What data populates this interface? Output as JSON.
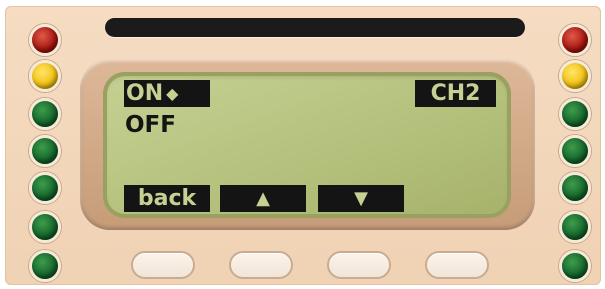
{
  "display": {
    "selected_option": "ON",
    "selection_marker": "◆",
    "other_option": "OFF",
    "channel": "CH2"
  },
  "softkey_labels": {
    "back": "back",
    "up": "▲",
    "down": "▼"
  },
  "leds": {
    "left": [
      "red",
      "yellow",
      "green",
      "green",
      "green",
      "green",
      "green"
    ],
    "right": [
      "red",
      "yellow",
      "green",
      "green",
      "green",
      "green",
      "green"
    ]
  },
  "colors": {
    "panel": "#f2d6b9",
    "lcd": "#b8c47f",
    "lcd_text": "#141414",
    "led_red": "#a3140d",
    "led_yellow": "#f0bf10",
    "led_green": "#12632a"
  }
}
